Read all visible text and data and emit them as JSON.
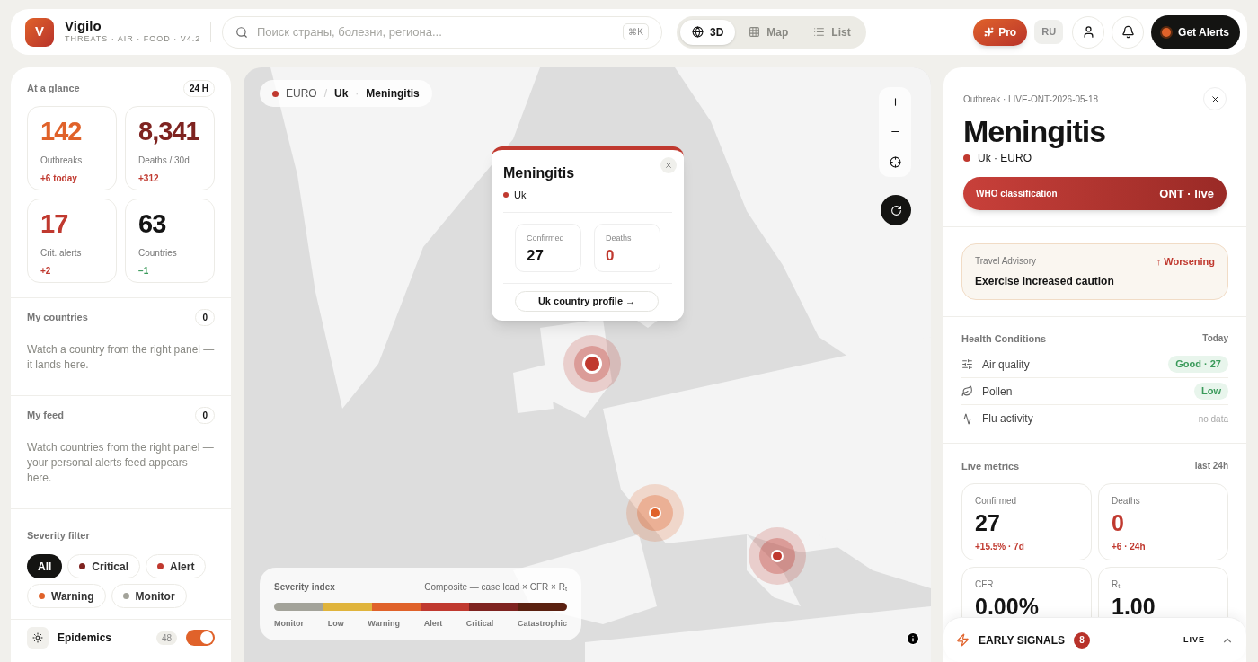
{
  "brand": {
    "logo": "V",
    "name": "Vigilo",
    "tagline": "THREATS · AIR · FOOD · V4.2"
  },
  "search": {
    "placeholder": "Поиск страны, болезни, региона...",
    "shortcut": "⌘K"
  },
  "views": [
    {
      "label": "3D",
      "selected": true
    },
    {
      "label": "Map",
      "selected": false
    },
    {
      "label": "List",
      "selected": false
    }
  ],
  "header_actions": {
    "pro": "Pro",
    "language": "RU",
    "alerts": "Get Alerts"
  },
  "glance": {
    "title": "At a glance",
    "period": "24 H",
    "stats": [
      {
        "value": "142",
        "label": "Outbreaks",
        "delta": "+6 today",
        "color": "#e0622a",
        "kind": "rise"
      },
      {
        "value": "8,341",
        "label": "Deaths / 30d",
        "delta": "+312",
        "color": "#7e2320",
        "kind": "rise"
      },
      {
        "value": "17",
        "label": "Crit. alerts",
        "delta": "+2",
        "color": "#c0392f",
        "kind": "rise"
      },
      {
        "value": "63",
        "label": "Countries",
        "delta": "−1",
        "color": "#141414",
        "kind": "fall"
      }
    ]
  },
  "my_countries": {
    "title": "My countries",
    "count": "0",
    "text": "Watch a country from the right panel — it lands here."
  },
  "my_feed": {
    "title": "My feed",
    "count": "0",
    "text": "Watch countries from the right panel — your personal alerts feed appears here."
  },
  "severity_filter": {
    "title": "Severity filter",
    "chips": [
      {
        "label": "All",
        "selected": true
      },
      {
        "label": "Critical",
        "selected": false,
        "color": "#7e2320"
      },
      {
        "label": "Alert",
        "selected": false,
        "color": "#c0392f"
      },
      {
        "label": "Warning",
        "selected": false,
        "color": "#e0622a"
      },
      {
        "label": "Monitor",
        "selected": false,
        "color": "#a3a39a"
      }
    ]
  },
  "layer": {
    "label": "Epidemics",
    "count": "48",
    "on": true
  },
  "breadcrumb": {
    "items": [
      {
        "label": "EURO"
      },
      {
        "separator": "/",
        "label": "Uk"
      },
      {
        "separator": "·",
        "label": "Meningitis"
      }
    ]
  },
  "markers": [
    {
      "color": "#c0392f",
      "kind": "selected"
    },
    {
      "color": "#e0622a",
      "kind": "normal"
    },
    {
      "color": "#c0392f",
      "kind": "normal"
    }
  ],
  "popup": {
    "title": "Meningitis",
    "country": "Uk",
    "stats": [
      {
        "label": "Confirmed",
        "value": "27",
        "highlight": false
      },
      {
        "label": "Deaths",
        "value": "0",
        "highlight": true
      }
    ],
    "link": "Uk country profile →"
  },
  "legend": {
    "title": "Severity index",
    "formula": "Composite — case load × CFR × R$_{t}$",
    "levels": [
      {
        "label": "Monitor",
        "color": "#a3a39a"
      },
      {
        "label": "Low",
        "color": "#e0b43c"
      },
      {
        "label": "Warning",
        "color": "#e0622a"
      },
      {
        "label": "Alert",
        "color": "#c0392f"
      },
      {
        "label": "Critical",
        "color": "#7e2320"
      },
      {
        "label": "Catastrophic",
        "color": "#5a2010"
      }
    ]
  },
  "detail": {
    "kicker": "Outbreak · LIVE-ONT-2026-05-18",
    "title": "Meningitis",
    "location": "Uk · EURO",
    "who": {
      "label": "WHO classification",
      "value": "ONT · live"
    },
    "advisory": {
      "label": "Travel Advisory",
      "trend": "↑ Worsening",
      "text": "Exercise increased caution"
    },
    "health": {
      "title": "Health Conditions",
      "period": "Today",
      "rows": [
        {
          "label": "Air quality",
          "value": "Good · 27",
          "kind": "badge"
        },
        {
          "label": "Pollen",
          "value": "Low",
          "kind": "badge"
        },
        {
          "label": "Flu activity",
          "value": "no data",
          "kind": "muted"
        }
      ]
    },
    "metrics": {
      "title": "Live metrics",
      "period": "last 24h",
      "cards": [
        {
          "label": "Confirmed",
          "value": "27",
          "delta": "+15.5% · 7d",
          "highlight": false
        },
        {
          "label": "Deaths",
          "value": "0",
          "delta": "+6 · 24h",
          "highlight": true
        },
        {
          "label": "CFR",
          "value": "0.00%",
          "highlight": false
        },
        {
          "label": "R$_{t}$",
          "value": "1.00",
          "highlight": false
        }
      ]
    }
  },
  "signals": {
    "label": "EARLY SIGNALS",
    "count": "8",
    "status": "LIVE"
  }
}
